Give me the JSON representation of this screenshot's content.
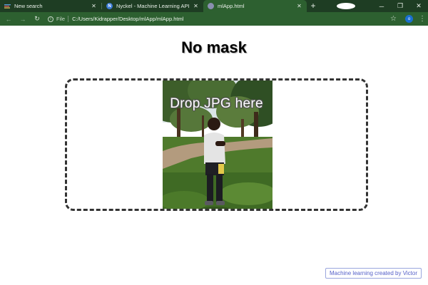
{
  "browser": {
    "tabs": [
      {
        "title": "New search",
        "icon": "stripes-icon",
        "active": false
      },
      {
        "title": "Nyckel - Machine Learning API",
        "icon": "nyckel-icon",
        "icon_letter": "N",
        "active": false
      },
      {
        "title": "mlApp.html",
        "icon": "globe-icon",
        "active": true
      }
    ],
    "new_tab_label": "+",
    "address": {
      "scheme": "File",
      "url": "C:/Users/Kidrapper/Desktop/mlApp/mlApp.html"
    },
    "profile_initial": "o",
    "colors": {
      "frame": "#1e3d23",
      "toolbar": "#2d6030",
      "avatar": "#1a6fcf"
    }
  },
  "page": {
    "title": "No mask",
    "dropzone": {
      "label": "Drop JPG here"
    },
    "credit": "Machine learning created by Victor"
  }
}
